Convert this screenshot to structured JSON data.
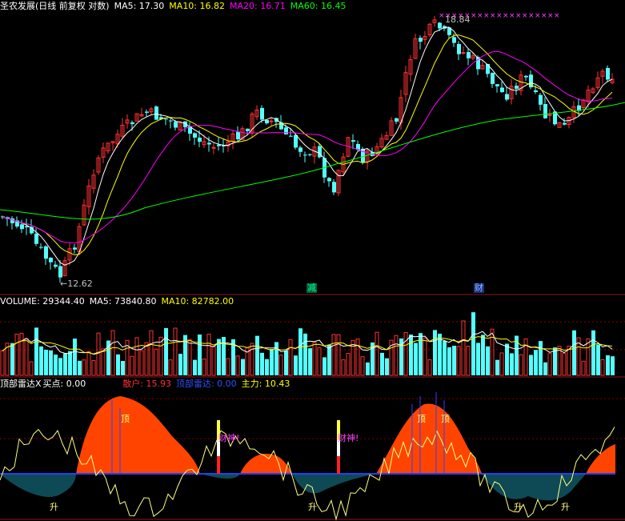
{
  "price_panel": {
    "header": {
      "title": "圣农发展(日线 前复权 对数)",
      "ma5": "MA5: 17.30",
      "ma10": "MA10: 16.82",
      "ma20": "MA20: 16.71",
      "ma60": "MA60: 16.45"
    },
    "high_label": "18.84",
    "low_label": "12.62",
    "markers": {
      "jian": "减",
      "cai": "财"
    },
    "ma_colors": {
      "ma5": "#ffffff",
      "ma10": "#ffff00",
      "ma20": "#ff00ff",
      "ma60": "#00ff00"
    }
  },
  "volume_panel": {
    "header": {
      "volume": "VOLUME: 29344.40",
      "ma5": "MA5: 73840.80",
      "ma10": "MA10: 82782.00"
    }
  },
  "indicator_panel": {
    "header": {
      "name": "顶部雷达X",
      "buy": "买点: 0.00",
      "retail": "散户: 15.93",
      "radar": "顶部雷达: 0.00",
      "main": "主力: 10.43"
    },
    "labels": {
      "top1": "顶",
      "top2": "顶",
      "top3": "顶",
      "caishen1": "财神!",
      "caishen2": "财神!",
      "rise1": "升",
      "rise2": "升",
      "rise3": "升",
      "rise4": "升"
    }
  },
  "colors": {
    "up": "#ff3232",
    "down": "#54ffff",
    "grid": "#8b0000",
    "retail_fill": "#ff4400",
    "main_fill": "#0e4a55"
  }
}
